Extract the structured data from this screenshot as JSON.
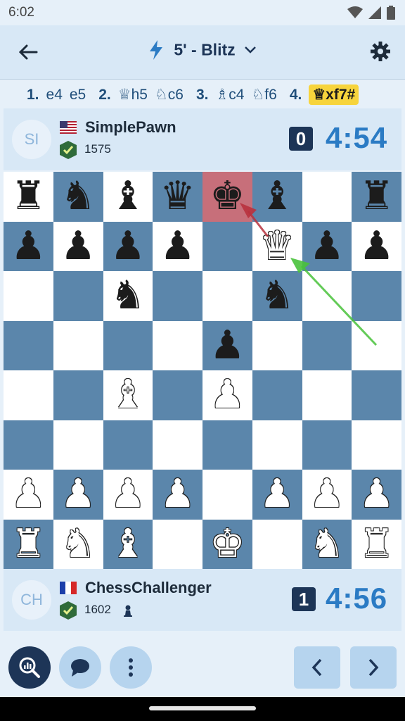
{
  "status": {
    "time": "6:02"
  },
  "header": {
    "title": "5' - Blitz"
  },
  "moves": [
    {
      "num": "1.",
      "white": "e4",
      "black": "e5"
    },
    {
      "num": "2.",
      "white": "♕h5",
      "black": "♘c6"
    },
    {
      "num": "3.",
      "white": "♗c4",
      "black": "♘f6"
    },
    {
      "num": "4.",
      "white": "♕xf7#",
      "black": ""
    }
  ],
  "players": {
    "top": {
      "initials": "SI",
      "name": "SimplePawn",
      "rating": "1575",
      "score": "0",
      "clock": "4:54"
    },
    "bottom": {
      "initials": "CH",
      "name": "ChessChallenger",
      "rating": "1602",
      "score": "1",
      "clock": "4:56"
    }
  },
  "board": {
    "light": "#ffffff",
    "dark": "#5b86ab",
    "highlight": "#c76f7a",
    "rows": [
      "rnbqkb.r",
      "pppp.Qpp",
      "..n..n..",
      "....p...",
      "..B.P...",
      "........",
      "PPPP.PPP",
      "RNB.K.NR"
    ]
  },
  "colors": {
    "accent": "#2b7bc4",
    "navy": "#1d3557",
    "lastmove": "#f7d43c"
  }
}
